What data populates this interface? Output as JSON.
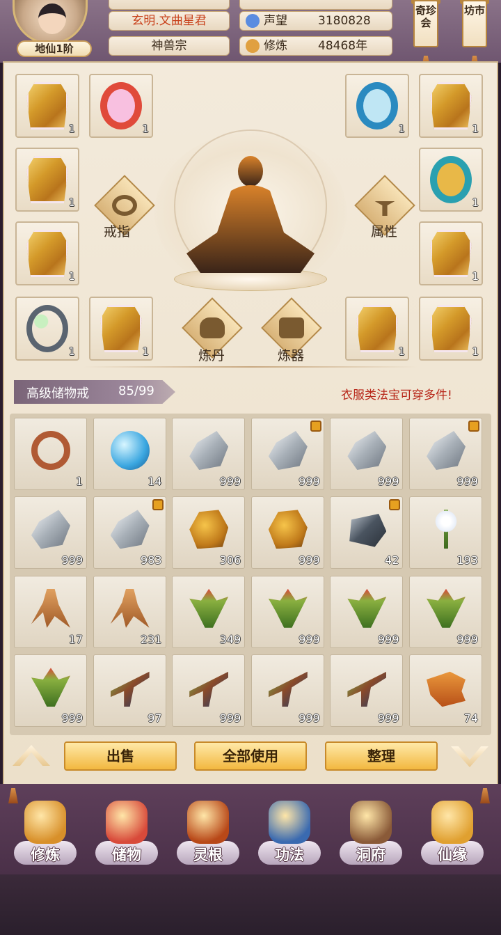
{
  "header": {
    "rank": "地仙1阶",
    "title": "玄明.文曲星君",
    "sect": "神兽宗",
    "stats": [
      {
        "label": "声望",
        "value": "3180828",
        "icon": "reputation-icon",
        "color": "#5a8ce0"
      },
      {
        "label": "修炼",
        "value": "48468年",
        "icon": "meditation-icon",
        "color": "#e0a040"
      }
    ],
    "banners": [
      {
        "label": "奇珍会"
      },
      {
        "label": "坊市"
      }
    ]
  },
  "equipment": {
    "left_slots": [
      {
        "icon": "golden-robe-icon",
        "count": "1"
      },
      {
        "icon": "fire-ring-icon",
        "count": "1"
      },
      {
        "icon": "golden-robe-icon",
        "count": "1"
      },
      {
        "icon": "golden-robe-icon",
        "count": "1"
      },
      {
        "icon": "jade-ring-icon",
        "count": "1"
      },
      {
        "icon": "golden-robe-icon",
        "count": "1"
      }
    ],
    "right_slots": [
      {
        "icon": "azure-ring-icon",
        "count": "1"
      },
      {
        "icon": "golden-robe-icon",
        "count": "1"
      },
      {
        "icon": "dragon-ring-icon",
        "count": "1"
      },
      {
        "icon": "golden-robe-icon",
        "count": "1"
      },
      {
        "icon": "golden-robe-icon",
        "count": "1"
      },
      {
        "icon": "golden-robe-icon",
        "count": "1"
      }
    ],
    "functions": {
      "ring": "戒指",
      "attributes": "属性",
      "alchemy": "炼丹",
      "forge": "炼器"
    }
  },
  "storage": {
    "title": "高级储物戒",
    "capacity": "85/99",
    "tip": "衣服类法宝可穿多件!",
    "items": [
      {
        "icon": "ring-icon",
        "shape": "shape-ring",
        "count": "1",
        "locked": false
      },
      {
        "icon": "crystal-orb-icon",
        "shape": "shape-orb",
        "count": "14",
        "locked": false
      },
      {
        "icon": "ore-icon",
        "shape": "shape-ore",
        "count": "999",
        "locked": false
      },
      {
        "icon": "ore-icon",
        "shape": "shape-ore",
        "count": "999",
        "locked": true
      },
      {
        "icon": "ore-icon",
        "shape": "shape-ore",
        "count": "999",
        "locked": false
      },
      {
        "icon": "ore-icon",
        "shape": "shape-ore",
        "count": "999",
        "locked": true
      },
      {
        "icon": "ore-icon",
        "shape": "shape-ore",
        "count": "999",
        "locked": false
      },
      {
        "icon": "ore-icon",
        "shape": "shape-ore",
        "count": "983",
        "locked": true
      },
      {
        "icon": "gold-ore-icon",
        "shape": "shape-gold",
        "count": "306",
        "locked": false
      },
      {
        "icon": "gold-ore-icon",
        "shape": "shape-gold",
        "count": "999",
        "locked": false
      },
      {
        "icon": "dark-iron-icon",
        "shape": "shape-dark",
        "count": "42",
        "locked": true
      },
      {
        "icon": "white-lily-icon",
        "shape": "shape-flower",
        "count": "193",
        "locked": false
      },
      {
        "icon": "ginseng-icon",
        "shape": "shape-root",
        "count": "17",
        "locked": false
      },
      {
        "icon": "root-herb-icon",
        "shape": "shape-root",
        "count": "231",
        "locked": false
      },
      {
        "icon": "herb-icon",
        "shape": "shape-herb",
        "count": "349",
        "locked": false
      },
      {
        "icon": "herb-icon",
        "shape": "shape-herb",
        "count": "999",
        "locked": false
      },
      {
        "icon": "herb-icon",
        "shape": "shape-herb",
        "count": "999",
        "locked": false
      },
      {
        "icon": "herb-icon",
        "shape": "shape-herb",
        "count": "999",
        "locked": false
      },
      {
        "icon": "herb-icon",
        "shape": "shape-herb",
        "count": "999",
        "locked": false
      },
      {
        "icon": "berry-branch-icon",
        "shape": "shape-branch",
        "count": "97",
        "locked": false
      },
      {
        "icon": "berry-branch-icon",
        "shape": "shape-branch",
        "count": "999",
        "locked": false
      },
      {
        "icon": "berry-branch-icon",
        "shape": "shape-branch",
        "count": "999",
        "locked": false
      },
      {
        "icon": "berry-branch-icon",
        "shape": "shape-branch",
        "count": "999",
        "locked": false
      },
      {
        "icon": "cordyceps-icon",
        "shape": "shape-worm",
        "count": "74",
        "locked": false
      }
    ]
  },
  "actions": {
    "sell": "出售",
    "use_all": "全部使用",
    "sort": "整理"
  },
  "nav": [
    {
      "label": "修炼",
      "icon": "meditate-nav-icon",
      "color": "#d8902a"
    },
    {
      "label": "储物",
      "icon": "pouch-nav-icon",
      "color": "#d84a3a"
    },
    {
      "label": "灵根",
      "icon": "spirit-root-nav-icon",
      "color": "#b84818"
    },
    {
      "label": "功法",
      "icon": "scripture-nav-icon",
      "color": "#3a6ab0"
    },
    {
      "label": "洞府",
      "icon": "cave-nav-icon",
      "color": "#8a5a38"
    },
    {
      "label": "仙缘",
      "icon": "gourd-nav-icon",
      "color": "#e0a030"
    }
  ]
}
